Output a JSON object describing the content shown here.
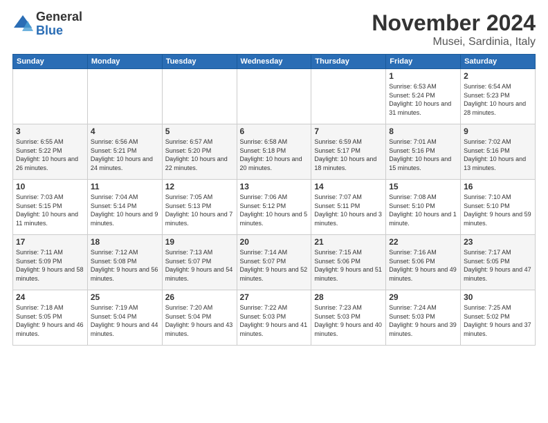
{
  "logo": {
    "general": "General",
    "blue": "Blue"
  },
  "header": {
    "title": "November 2024",
    "location": "Musei, Sardinia, Italy"
  },
  "weekdays": [
    "Sunday",
    "Monday",
    "Tuesday",
    "Wednesday",
    "Thursday",
    "Friday",
    "Saturday"
  ],
  "weeks": [
    [
      {
        "day": "",
        "info": ""
      },
      {
        "day": "",
        "info": ""
      },
      {
        "day": "",
        "info": ""
      },
      {
        "day": "",
        "info": ""
      },
      {
        "day": "",
        "info": ""
      },
      {
        "day": "1",
        "info": "Sunrise: 6:53 AM\nSunset: 5:24 PM\nDaylight: 10 hours and 31 minutes."
      },
      {
        "day": "2",
        "info": "Sunrise: 6:54 AM\nSunset: 5:23 PM\nDaylight: 10 hours and 28 minutes."
      }
    ],
    [
      {
        "day": "3",
        "info": "Sunrise: 6:55 AM\nSunset: 5:22 PM\nDaylight: 10 hours and 26 minutes."
      },
      {
        "day": "4",
        "info": "Sunrise: 6:56 AM\nSunset: 5:21 PM\nDaylight: 10 hours and 24 minutes."
      },
      {
        "day": "5",
        "info": "Sunrise: 6:57 AM\nSunset: 5:20 PM\nDaylight: 10 hours and 22 minutes."
      },
      {
        "day": "6",
        "info": "Sunrise: 6:58 AM\nSunset: 5:18 PM\nDaylight: 10 hours and 20 minutes."
      },
      {
        "day": "7",
        "info": "Sunrise: 6:59 AM\nSunset: 5:17 PM\nDaylight: 10 hours and 18 minutes."
      },
      {
        "day": "8",
        "info": "Sunrise: 7:01 AM\nSunset: 5:16 PM\nDaylight: 10 hours and 15 minutes."
      },
      {
        "day": "9",
        "info": "Sunrise: 7:02 AM\nSunset: 5:16 PM\nDaylight: 10 hours and 13 minutes."
      }
    ],
    [
      {
        "day": "10",
        "info": "Sunrise: 7:03 AM\nSunset: 5:15 PM\nDaylight: 10 hours and 11 minutes."
      },
      {
        "day": "11",
        "info": "Sunrise: 7:04 AM\nSunset: 5:14 PM\nDaylight: 10 hours and 9 minutes."
      },
      {
        "day": "12",
        "info": "Sunrise: 7:05 AM\nSunset: 5:13 PM\nDaylight: 10 hours and 7 minutes."
      },
      {
        "day": "13",
        "info": "Sunrise: 7:06 AM\nSunset: 5:12 PM\nDaylight: 10 hours and 5 minutes."
      },
      {
        "day": "14",
        "info": "Sunrise: 7:07 AM\nSunset: 5:11 PM\nDaylight: 10 hours and 3 minutes."
      },
      {
        "day": "15",
        "info": "Sunrise: 7:08 AM\nSunset: 5:10 PM\nDaylight: 10 hours and 1 minute."
      },
      {
        "day": "16",
        "info": "Sunrise: 7:10 AM\nSunset: 5:10 PM\nDaylight: 9 hours and 59 minutes."
      }
    ],
    [
      {
        "day": "17",
        "info": "Sunrise: 7:11 AM\nSunset: 5:09 PM\nDaylight: 9 hours and 58 minutes."
      },
      {
        "day": "18",
        "info": "Sunrise: 7:12 AM\nSunset: 5:08 PM\nDaylight: 9 hours and 56 minutes."
      },
      {
        "day": "19",
        "info": "Sunrise: 7:13 AM\nSunset: 5:07 PM\nDaylight: 9 hours and 54 minutes."
      },
      {
        "day": "20",
        "info": "Sunrise: 7:14 AM\nSunset: 5:07 PM\nDaylight: 9 hours and 52 minutes."
      },
      {
        "day": "21",
        "info": "Sunrise: 7:15 AM\nSunset: 5:06 PM\nDaylight: 9 hours and 51 minutes."
      },
      {
        "day": "22",
        "info": "Sunrise: 7:16 AM\nSunset: 5:06 PM\nDaylight: 9 hours and 49 minutes."
      },
      {
        "day": "23",
        "info": "Sunrise: 7:17 AM\nSunset: 5:05 PM\nDaylight: 9 hours and 47 minutes."
      }
    ],
    [
      {
        "day": "24",
        "info": "Sunrise: 7:18 AM\nSunset: 5:05 PM\nDaylight: 9 hours and 46 minutes."
      },
      {
        "day": "25",
        "info": "Sunrise: 7:19 AM\nSunset: 5:04 PM\nDaylight: 9 hours and 44 minutes."
      },
      {
        "day": "26",
        "info": "Sunrise: 7:20 AM\nSunset: 5:04 PM\nDaylight: 9 hours and 43 minutes."
      },
      {
        "day": "27",
        "info": "Sunrise: 7:22 AM\nSunset: 5:03 PM\nDaylight: 9 hours and 41 minutes."
      },
      {
        "day": "28",
        "info": "Sunrise: 7:23 AM\nSunset: 5:03 PM\nDaylight: 9 hours and 40 minutes."
      },
      {
        "day": "29",
        "info": "Sunrise: 7:24 AM\nSunset: 5:03 PM\nDaylight: 9 hours and 39 minutes."
      },
      {
        "day": "30",
        "info": "Sunrise: 7:25 AM\nSunset: 5:02 PM\nDaylight: 9 hours and 37 minutes."
      }
    ]
  ]
}
